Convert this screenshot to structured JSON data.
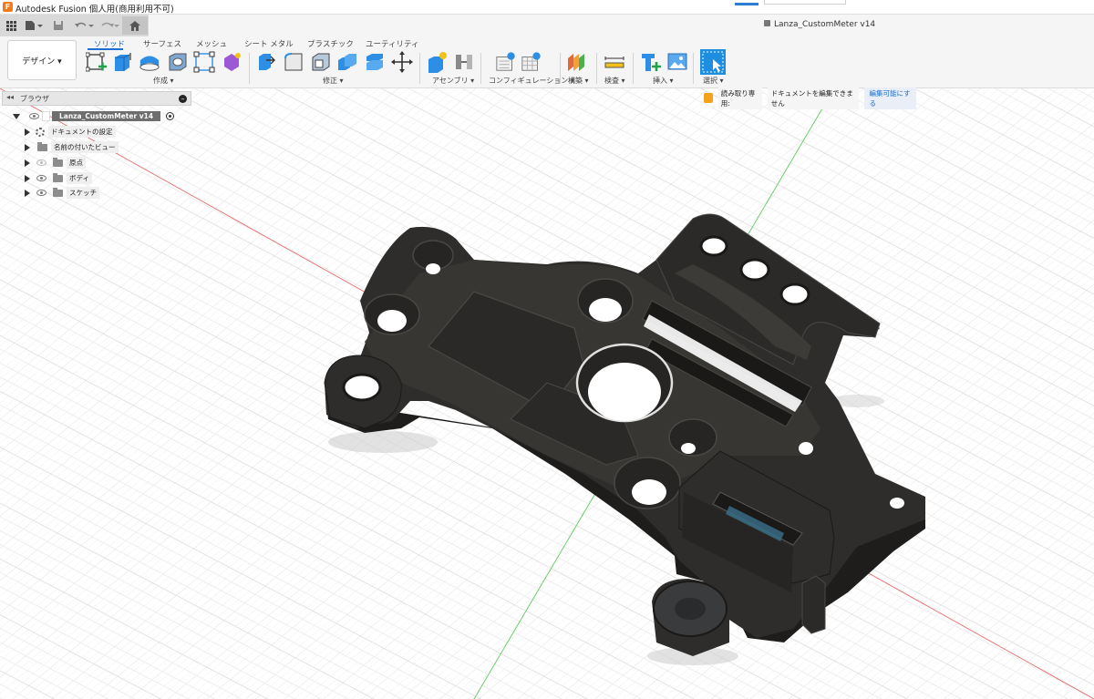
{
  "titlebar": {
    "app_title": "Autodesk Fusion 個人用(商用利用不可)"
  },
  "qab": {
    "doc_title": "Lanza_CustomMeter v14"
  },
  "ribbon": {
    "workspace": "デザイン ▾",
    "tabs": [
      "ソリッド",
      "サーフェス",
      "メッシュ",
      "シート メタル",
      "プラスチック",
      "ユーティリティ"
    ],
    "groups": [
      "作成 ▾",
      "修正 ▾",
      "アセンブリ ▾",
      "コンフィギュレーション ▾",
      "構築 ▾",
      "検査 ▾",
      "挿入 ▾",
      "選択 ▾"
    ]
  },
  "browser": {
    "title": "ブラウザ",
    "root": "Lanza_CustomMeter v14",
    "items": [
      "ドキュメントの設定",
      "名前の付いたビュー",
      "原点",
      "ボディ",
      "スケッチ"
    ]
  },
  "banner": {
    "readonly": "読み取り専用:",
    "message": "ドキュメントを編集できません",
    "action": "編集可能にする"
  },
  "colors": {
    "accent": "#1e6fcf",
    "part": "#2e2d2b",
    "part_face": "#3a3835",
    "grid": "#d6d6d6",
    "x_axis": "#e86a6a",
    "y_axis": "#5ccc5c",
    "warning": "#f3a21a"
  },
  "icons": [
    "grid-menu-icon",
    "file-icon",
    "save-icon",
    "undo-icon",
    "redo-icon",
    "home-icon",
    "lock-icon",
    "eye-icon",
    "folder-icon",
    "gear-icon"
  ]
}
